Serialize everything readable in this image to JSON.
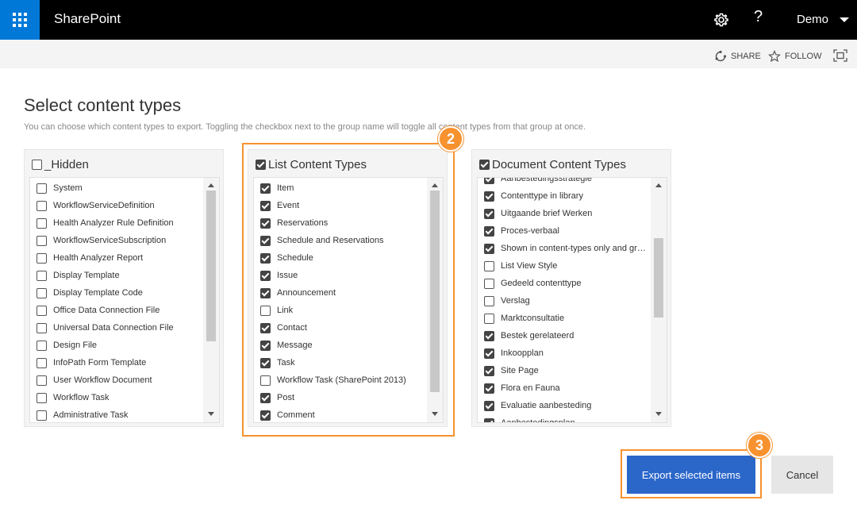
{
  "suite_bar": {
    "app_name": "SharePoint",
    "user_name": "Demo",
    "help_label": "?",
    "accent_color": "#0078d7"
  },
  "action_bar": {
    "share_label": "SHARE",
    "follow_label": "FOLLOW"
  },
  "page": {
    "title": "Select content types",
    "description": "You can choose which content types to export. Toggling the checkbox next to the group name will toggle all content types from that group at once."
  },
  "groups": [
    {
      "name": "_Hidden",
      "checked": false,
      "items": [
        {
          "label": "System",
          "checked": false
        },
        {
          "label": "WorkflowServiceDefinition",
          "checked": false
        },
        {
          "label": "Health Analyzer Rule Definition",
          "checked": false
        },
        {
          "label": "WorkflowServiceSubscription",
          "checked": false
        },
        {
          "label": "Health Analyzer Report",
          "checked": false
        },
        {
          "label": "Display Template",
          "checked": false
        },
        {
          "label": "Display Template Code",
          "checked": false
        },
        {
          "label": "Office Data Connection File",
          "checked": false
        },
        {
          "label": "Universal Data Connection File",
          "checked": false
        },
        {
          "label": "Design File",
          "checked": false
        },
        {
          "label": "InfoPath Form Template",
          "checked": false
        },
        {
          "label": "User Workflow Document",
          "checked": false
        },
        {
          "label": "Workflow Task",
          "checked": false
        },
        {
          "label": "Administrative Task",
          "checked": false
        }
      ]
    },
    {
      "name": "List Content Types",
      "checked": true,
      "items": [
        {
          "label": "Item",
          "checked": true
        },
        {
          "label": "Event",
          "checked": true
        },
        {
          "label": "Reservations",
          "checked": true
        },
        {
          "label": "Schedule and Reservations",
          "checked": true
        },
        {
          "label": "Schedule",
          "checked": true
        },
        {
          "label": "Issue",
          "checked": true
        },
        {
          "label": "Announcement",
          "checked": true
        },
        {
          "label": "Link",
          "checked": false
        },
        {
          "label": "Contact",
          "checked": true
        },
        {
          "label": "Message",
          "checked": true
        },
        {
          "label": "Task",
          "checked": true
        },
        {
          "label": "Workflow Task (SharePoint 2013)",
          "checked": false
        },
        {
          "label": "Post",
          "checked": true
        },
        {
          "label": "Comment",
          "checked": true
        }
      ]
    },
    {
      "name": "Document Content Types",
      "checked": true,
      "items": [
        {
          "label": "Aanbestedingsstrategie",
          "checked": true
        },
        {
          "label": "Contenttype in library",
          "checked": true
        },
        {
          "label": "Uitgaande brief Werken",
          "checked": true
        },
        {
          "label": "Proces-verbaal",
          "checked": true
        },
        {
          "label": "Shown in content-types only and gro…",
          "checked": true
        },
        {
          "label": "List View Style",
          "checked": false
        },
        {
          "label": "Gedeeld contenttype",
          "checked": false
        },
        {
          "label": "Verslag",
          "checked": false
        },
        {
          "label": "Marktconsultatie",
          "checked": false
        },
        {
          "label": "Bestek gerelateerd",
          "checked": true
        },
        {
          "label": "Inkoopplan",
          "checked": true
        },
        {
          "label": "Site Page",
          "checked": true
        },
        {
          "label": "Flora en Fauna",
          "checked": true
        },
        {
          "label": "Evaluatie aanbesteding",
          "checked": true
        },
        {
          "label": "Aanbestedingsplan",
          "checked": true
        }
      ]
    }
  ],
  "callouts": {
    "group_step": "2",
    "export_step": "3",
    "color": "#f7922f"
  },
  "buttons": {
    "export_label": "Export selected items",
    "cancel_label": "Cancel"
  }
}
